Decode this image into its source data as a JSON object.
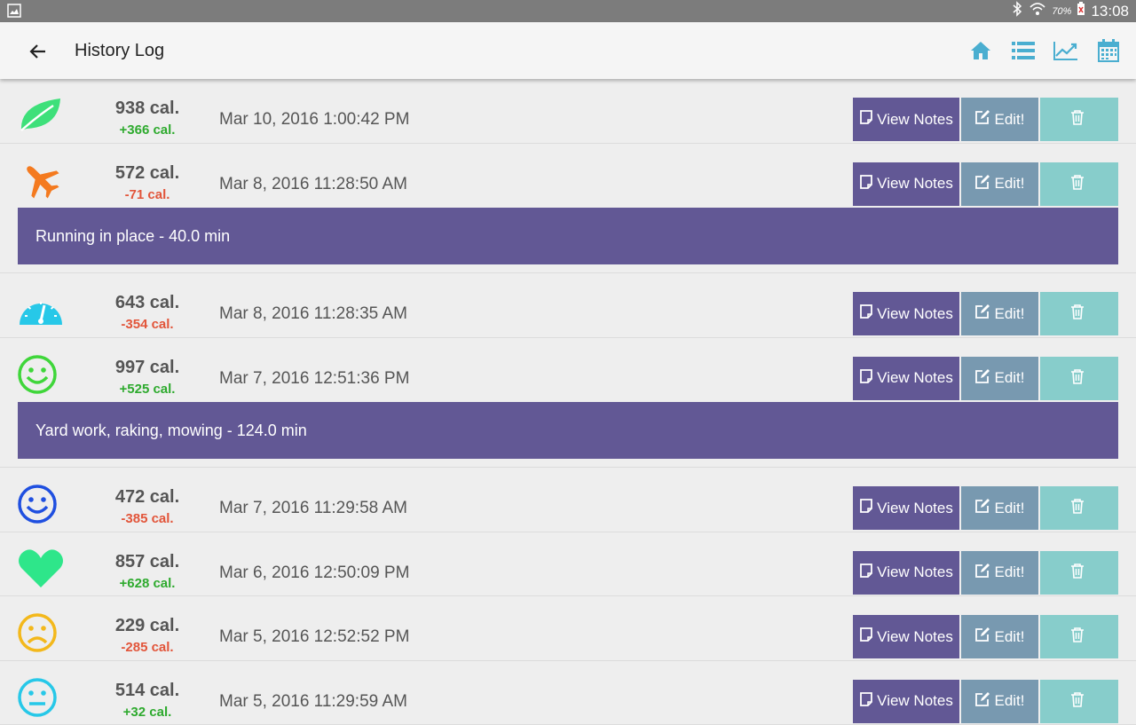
{
  "status_bar": {
    "battery": "70%",
    "time": "13:08"
  },
  "toolbar": {
    "title": "History Log"
  },
  "buttons": {
    "view_notes": "View Notes",
    "edit": "Edit!"
  },
  "entries": [
    {
      "icon": "leaf-icon",
      "icon_color": "#3ee07a",
      "calories": "938 cal.",
      "delta": "+366 cal.",
      "delta_sign": "pos",
      "datetime": "Mar 10, 2016 1:00:42 PM",
      "note": ""
    },
    {
      "icon": "airplane-icon",
      "icon_color": "#f47a1f",
      "calories": "572 cal.",
      "delta": "-71 cal.",
      "delta_sign": "neg",
      "datetime": "Mar 8, 2016 11:28:50 AM",
      "note": "Running in place - 40.0 min"
    },
    {
      "icon": "gauge-icon",
      "icon_color": "#27c8e8",
      "calories": "643 cal.",
      "delta": "-354 cal.",
      "delta_sign": "neg",
      "datetime": "Mar 8, 2016 11:28:35 AM",
      "note": ""
    },
    {
      "icon": "smiley-icon",
      "icon_color": "#3fd63a",
      "calories": "997 cal.",
      "delta": "+525 cal.",
      "delta_sign": "pos",
      "datetime": "Mar 7, 2016 12:51:36 PM",
      "note": "Yard work, raking, mowing - 124.0 min"
    },
    {
      "icon": "smiley-icon",
      "icon_color": "#1f4fe0",
      "calories": "472 cal.",
      "delta": "-385 cal.",
      "delta_sign": "neg",
      "datetime": "Mar 7, 2016 11:29:58 AM",
      "note": ""
    },
    {
      "icon": "heart-icon",
      "icon_color": "#2ee68a",
      "calories": "857 cal.",
      "delta": "+628 cal.",
      "delta_sign": "pos",
      "datetime": "Mar 6, 2016 12:50:09 PM",
      "note": ""
    },
    {
      "icon": "sad-face-icon",
      "icon_color": "#f3b81b",
      "calories": "229 cal.",
      "delta": "-285 cal.",
      "delta_sign": "neg",
      "datetime": "Mar 5, 2016 12:52:52 PM",
      "note": ""
    },
    {
      "icon": "neutral-face-icon",
      "icon_color": "#27c8e8",
      "calories": "514 cal.",
      "delta": "+32 cal.",
      "delta_sign": "pos",
      "datetime": "Mar 5, 2016 11:29:59 AM",
      "note": ""
    }
  ],
  "colors": {
    "accent": "#625895",
    "edit": "#7899b0",
    "delete": "#87cdcb",
    "toolbar_icons": "#4aaed0",
    "positive": "#2eaa2e",
    "negative": "#e2553a"
  }
}
